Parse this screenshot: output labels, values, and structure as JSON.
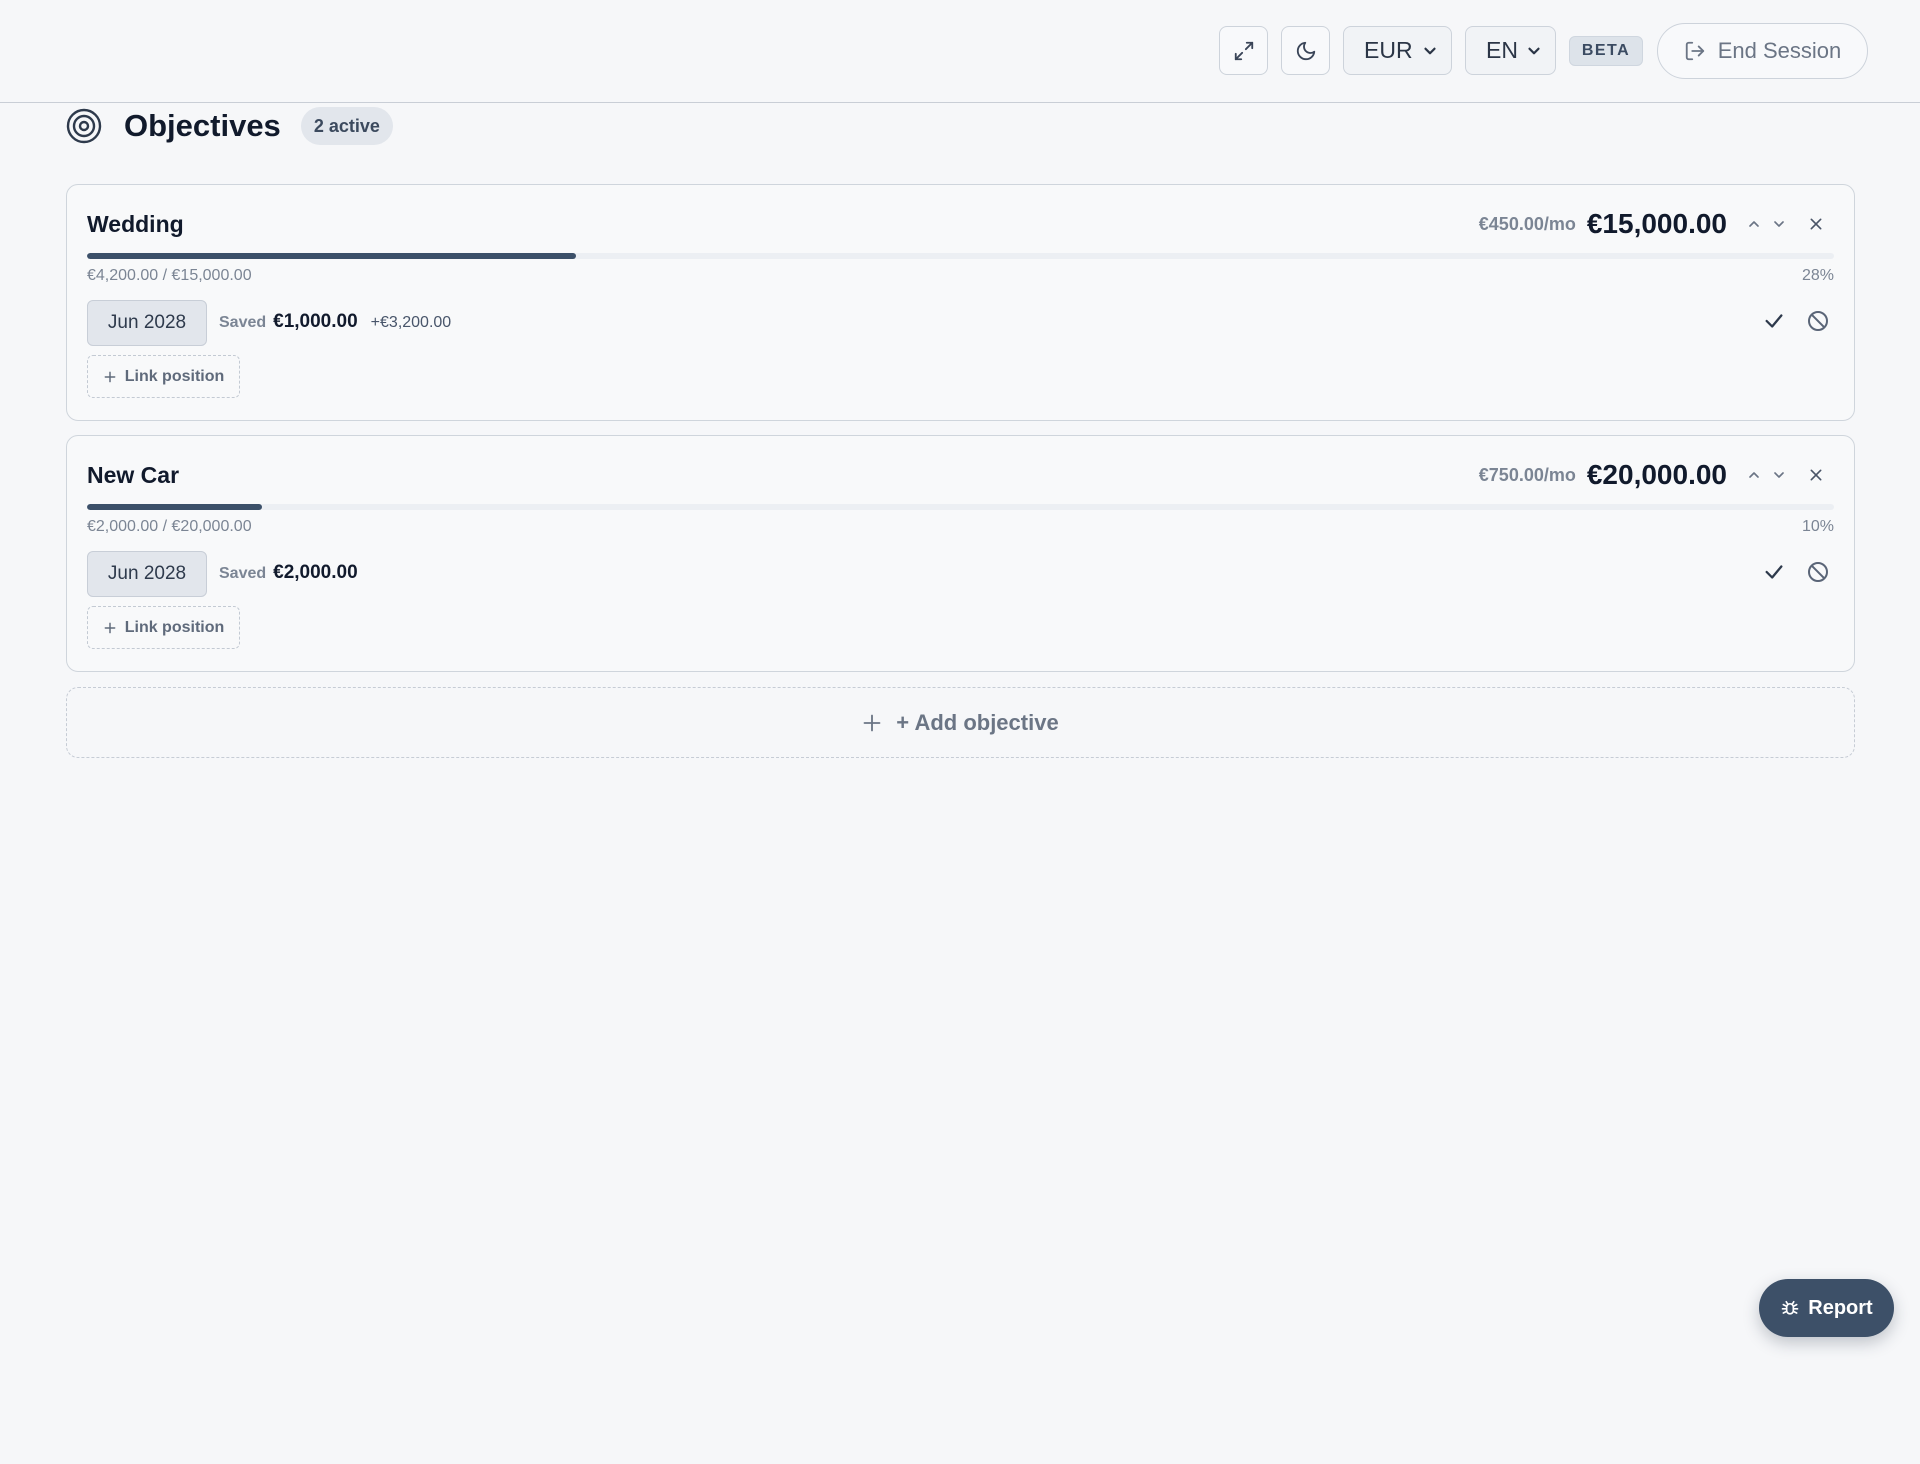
{
  "header": {
    "fullscreen_icon": "expand-icon",
    "theme_icon": "moon-icon",
    "currency": "EUR",
    "language": "EN",
    "beta_label": "BETA",
    "end_session_label": "End Session"
  },
  "objectives": {
    "title": "Objectives",
    "active_count_label": "2 active",
    "add_label": "+ Add objective",
    "items": [
      {
        "name": "Wedding",
        "monthly": "€450.00/mo",
        "target": "€15,000.00",
        "progress_text": "€4,200.00 / €15,000.00",
        "percent": "28%",
        "progress_fraction": 0.28,
        "date": "Jun 2028",
        "saved_label": "Saved",
        "saved_value": "€1,000.00",
        "saved_extra": "+€3,200.00",
        "link_label": "Link position"
      },
      {
        "name": "New Car",
        "monthly": "€750.00/mo",
        "target": "€20,000.00",
        "progress_text": "€2,000.00 / €20,000.00",
        "percent": "10%",
        "progress_fraction": 0.1,
        "date": "Jun 2028",
        "saved_label": "Saved",
        "saved_value": "€2,000.00",
        "saved_extra": "",
        "link_label": "Link position"
      }
    ]
  },
  "report_label": "Report",
  "colors": {
    "accent": "#3c5069",
    "background": "#f6f7f9",
    "text": "#111a2c",
    "muted": "#7b8594"
  }
}
